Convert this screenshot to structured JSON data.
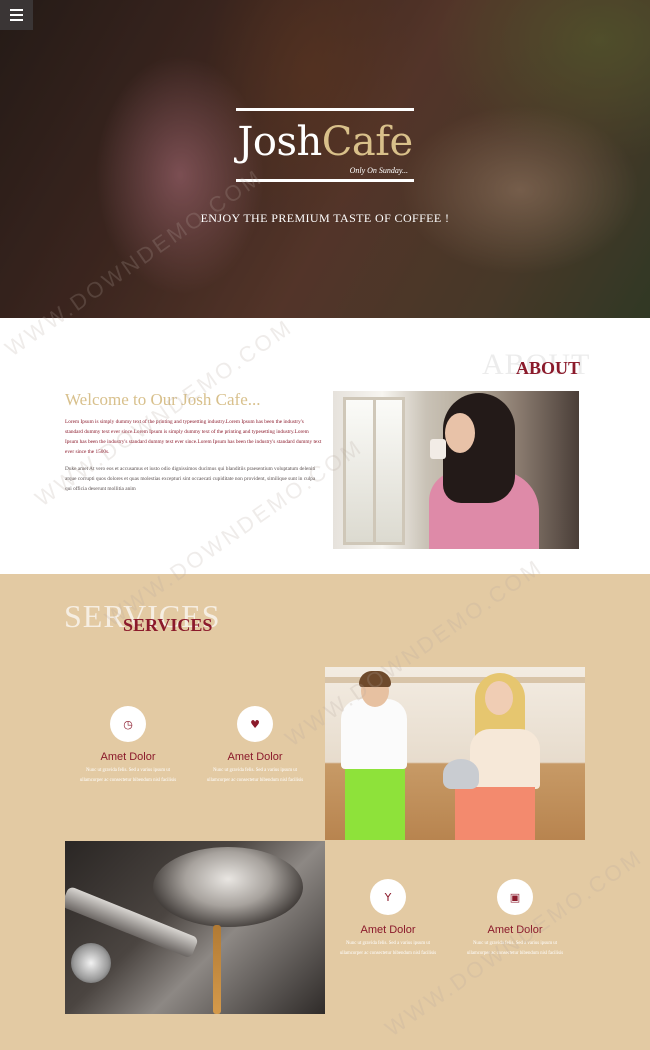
{
  "nav": {
    "menu_icon": "hamburger-menu-icon"
  },
  "hero": {
    "logo_part1": "Josh",
    "logo_part2": "Cafe",
    "logo_tagline": "Only On Sunday...",
    "tagline": "ENJOY THE PREMIUM TASTE OF COFFEE !"
  },
  "about": {
    "ghost_heading": "ABOUT",
    "heading": "ABOUT",
    "title": "Welcome to Our Josh Cafe...",
    "paragraph1": "Lorem Ipsum is simply dummy text of the printing and typesetting industry.Lorem Ipsum has been the industry's standard dummy text ever since.Lorem Ipsum is simply dummy text of the printing and typesetting industry.Lorem Ipsum has been the industry's standard dummy text ever since.Lorem Ipsum has been the industry's standard dummy text ever since the 1500s.",
    "paragraph2": "Duke amet At vero eos et accusamus et iusto odio dignissimos ducimus qui blanditiis praesentium voluptatum deleniti atque corrupti quos dolores et quas molestias excepturi sint occaecati cupiditate non provident, similique sunt in culpa qui officia deserunt mollitia anim"
  },
  "services": {
    "ghost_heading": "SERVICES",
    "heading": "SERVICES",
    "items": [
      {
        "icon": "clock-icon",
        "glyph": "◷",
        "title": "Amet Dolor",
        "text": "Nunc ut gravida felis. Sed a varius ipsum ut ullamcorper ac consectetur bibendum nisl facilisis"
      },
      {
        "icon": "heart-icon",
        "glyph": "♥",
        "title": "Amet Dolor",
        "text": "Nunc ut gravida felis. Sed a varius ipsum ut ullamcorper ac consectetur bibendum nisl facilisis"
      },
      {
        "icon": "cocktail-glass-icon",
        "glyph": "Y",
        "title": "Amet Dolor",
        "text": "Nunc ut gravida felis. Sed a varius ipsum ut ullamcorper ac consectetur bibendum nisl facilisis"
      },
      {
        "icon": "gift-icon",
        "glyph": "▣",
        "title": "Amet Dolor",
        "text": "Nunc ut gravida felis. Sed a varius ipsum ut ullamcorper ac consectetur bibendum nisl facilisis"
      }
    ]
  },
  "watermark_text": "WWW.DOWNDEMO.COM",
  "colors": {
    "accent": "#8b1a2b",
    "gold": "#d8c08c",
    "services_bg": "#e3caa3"
  }
}
